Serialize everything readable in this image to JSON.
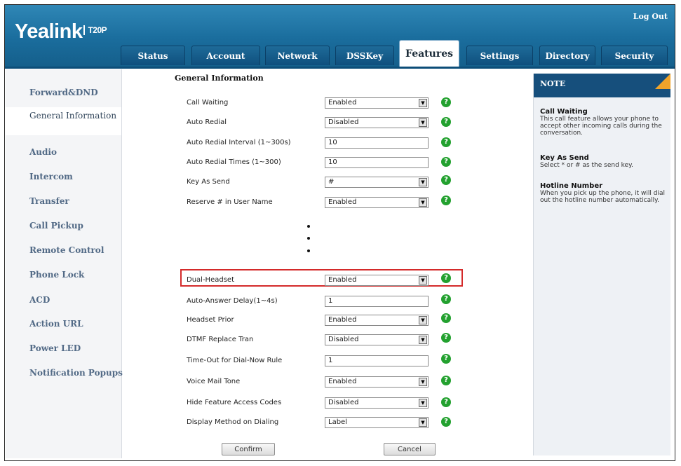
{
  "header": {
    "brand": "Yealink",
    "model": "T20P",
    "logout": "Log Out"
  },
  "tabs": [
    "Status",
    "Account",
    "Network",
    "DSSKey",
    "Features",
    "Settings",
    "Directory",
    "Security"
  ],
  "active_tab": "Features",
  "sidebar": {
    "items": [
      "Forward&DND",
      "General Information",
      "Audio",
      "Intercom",
      "Transfer",
      "Call Pickup",
      "Remote Control",
      "Phone Lock",
      "ACD",
      "Action URL",
      "Power LED",
      "Notification Popups"
    ],
    "active": "General Information"
  },
  "section": {
    "title": "General Information",
    "rows": [
      {
        "label": "Call Waiting",
        "value": "Enabled",
        "type": "select"
      },
      {
        "label": "Auto Redial",
        "value": "Disabled",
        "type": "select"
      },
      {
        "label": "Auto Redial Interval (1~300s)",
        "value": "10",
        "type": "input"
      },
      {
        "label": "Auto Redial Times (1~300)",
        "value": "10",
        "type": "input"
      },
      {
        "label": "Key As Send",
        "value": "#",
        "type": "select"
      },
      {
        "label": "Reserve # in User Name",
        "value": "Enabled",
        "type": "select"
      },
      {
        "label": "Dual-Headset",
        "value": "Enabled",
        "type": "select"
      },
      {
        "label": "Auto-Answer Delay(1~4s)",
        "value": "1",
        "type": "input"
      },
      {
        "label": "Headset Prior",
        "value": "Enabled",
        "type": "select"
      },
      {
        "label": "DTMF Replace Tran",
        "value": "Disabled",
        "type": "select"
      },
      {
        "label": "Time-Out for Dial-Now Rule",
        "value": "1",
        "type": "input"
      },
      {
        "label": "Voice Mail Tone",
        "value": "Enabled",
        "type": "select"
      },
      {
        "label": "Hide Feature Access Codes",
        "value": "Disabled",
        "type": "select"
      },
      {
        "label": "Display Method on Dialing",
        "value": "Label",
        "type": "select"
      }
    ],
    "help_glyph": "?",
    "dropdown_glyph": "▼"
  },
  "buttons": {
    "confirm": "Confirm",
    "cancel": "Cancel"
  },
  "note": {
    "title": "NOTE",
    "blocks": [
      {
        "title": "Call Waiting",
        "text": "This call feature allows your phone to accept other incoming calls during the conversation."
      },
      {
        "title": "Key As Send",
        "text": "Select * or # as the send key."
      },
      {
        "title": "Hotline Number",
        "text": "When you pick up the phone, it will dial out the hotline number automatically."
      }
    ]
  },
  "colors": {
    "header": "#1a6d9d",
    "help_icon": "#23a12f",
    "highlight": "#d42a2a",
    "note_header": "#164f7c",
    "note_corner": "#f0a42a"
  }
}
